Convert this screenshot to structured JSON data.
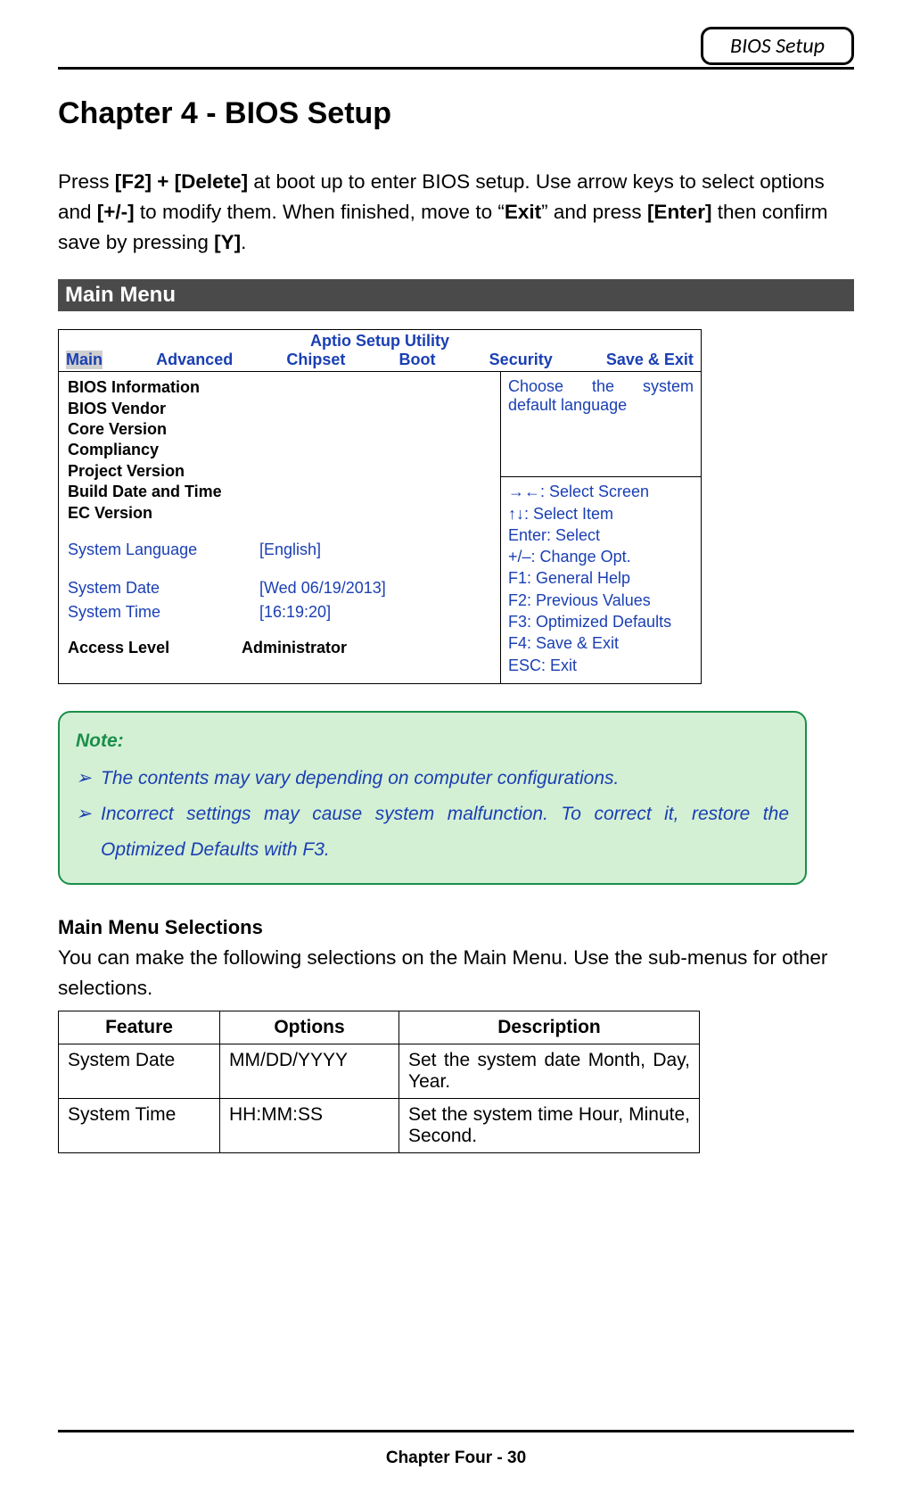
{
  "header": {
    "badge": "BIOS Setup"
  },
  "chapter_title": "Chapter 4 - BIOS Setup",
  "intro": {
    "p1a": "Press ",
    "p1b": "[F2] + [Delete]",
    "p1c": " at boot up to enter BIOS setup. Use arrow keys to select options and ",
    "p1d": "[+/-]",
    "p1e": " to modify them. When finished, move to “",
    "p1f": "Exit",
    "p1g": "” and press ",
    "p1h": "[Enter]",
    "p1i": " then confirm save by pressing ",
    "p1j": "[Y]",
    "p1k": "."
  },
  "section_bar": " Main Menu",
  "bios": {
    "title": "Aptio Setup Utility",
    "tabs": {
      "main": "Main",
      "advanced": "Advanced",
      "chipset": "Chipset",
      "boot": "Boot",
      "security": "Security",
      "save_exit": "Save & Exit"
    },
    "left": {
      "lines": {
        "l1": "BIOS Information",
        "l2": "BIOS Vendor",
        "l3": "Core Version",
        "l4": "Compliancy",
        "l5": "Project Version",
        "l6": "Build Date and Time",
        "l7": "EC Version"
      },
      "lang_label": "System Language",
      "lang_value": "[English]",
      "date_label": "System Date",
      "date_value": "[Wed 06/19/2013]",
      "time_label": "System Time",
      "time_value": "[16:19:20]",
      "access_label": "Access Level",
      "access_value": "Administrator"
    },
    "help": "Choose the system default language",
    "keys": {
      "k1": "→←: Select Screen",
      "k2": "↑↓: Select Item",
      "k3": "Enter: Select",
      "k4": "+/–: Change Opt.",
      "k5": "F1: General Help",
      "k6": "F2: Previous Values",
      "k7": "F3: Optimized Defaults",
      "k8": "F4: Save & Exit",
      "k9": "ESC: Exit"
    }
  },
  "note": {
    "title": "Note:",
    "arrow": "➢",
    "n1": "The contents may vary depending on computer configurations.",
    "n2": "Incorrect settings may cause system malfunction. To correct it, restore the Optimized Defaults with F3."
  },
  "selections": {
    "heading": "Main Menu Selections",
    "intro": "You can make the following selections on the Main Menu. Use the sub-menus for other selections.",
    "th": {
      "feature": "Feature",
      "options": "Options",
      "description": "Description"
    },
    "rows": [
      {
        "feature": "System Date",
        "options": "MM/DD/YYYY",
        "description": "Set the system date Month, Day, Year."
      },
      {
        "feature": "System Time",
        "options": "HH:MM:SS",
        "description": "Set the system time Hour, Minute, Second."
      }
    ]
  },
  "footer": "Chapter Four - 30"
}
